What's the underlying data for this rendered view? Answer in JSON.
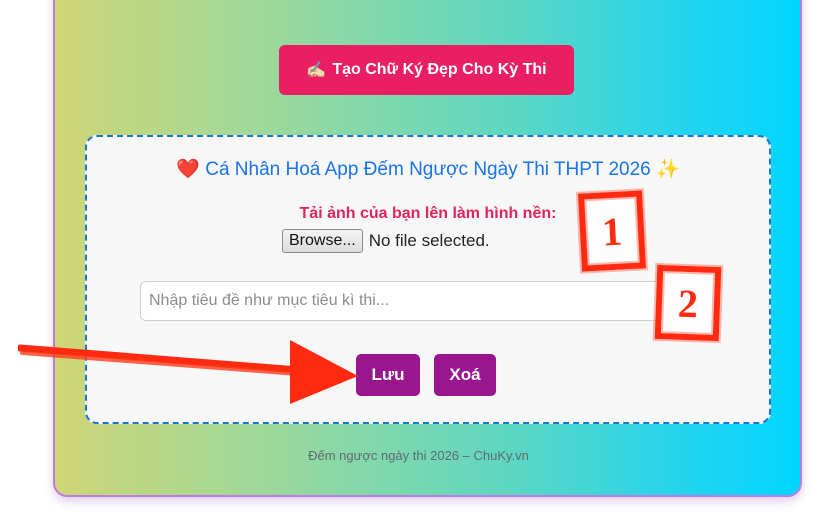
{
  "header": {
    "signature_button": "Tạo Chữ Ký Đẹp Cho Kỳ Thi",
    "signature_icon": "✍🏻"
  },
  "panel": {
    "title_prefix_icon": "❤️",
    "title": "Cá Nhân Hoá App Đếm Ngược Ngày Thi THPT 2026",
    "title_suffix_icon": "✨",
    "upload_label": "Tải ảnh của bạn lên làm hình nền:",
    "browse_label": "Browse...",
    "file_status": "No file selected.",
    "title_placeholder": "Nhập tiêu đề như mục tiêu kì thi...",
    "save_label": "Lưu",
    "delete_label": "Xoá"
  },
  "footer": {
    "text": "Đếm ngược ngày thi 2026 – ChuKy.vn"
  },
  "annotations": {
    "mark1": "1",
    "mark2": "2"
  },
  "colors": {
    "accent_pink": "#e91e63",
    "button_purple": "#9a168f",
    "annotation_red": "#ff2a10"
  }
}
